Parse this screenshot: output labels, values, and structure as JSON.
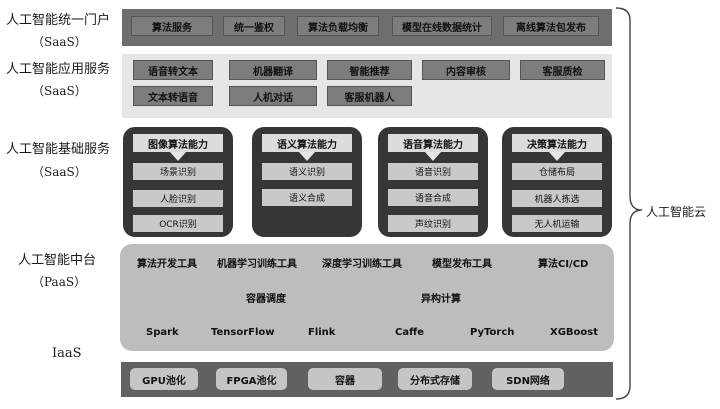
{
  "left_labels": {
    "portal_title": "人工智能统一门户",
    "portal_sub": "（SaaS）",
    "app_title": "人工智能应用服务",
    "app_sub": "（SaaS）",
    "basic_title": "人工智能基础服务",
    "basic_sub": "（SaaS）",
    "middle_title": "人工智能中台",
    "middle_sub": "（PaaS）",
    "iaas_title": "IaaS"
  },
  "portal": [
    "算法服务",
    "统一鉴权",
    "算法负载均衡",
    "模型在线数据统计",
    "离线算法包发布"
  ],
  "app_services": {
    "row1": [
      "语音转文本",
      "机器翻译",
      "智能推荐",
      "内容审核",
      "客服质检"
    ],
    "row2": [
      "文本转语音",
      "人机对话",
      "客服机器人"
    ]
  },
  "capabilities": [
    {
      "title": "图像算法能力",
      "items": [
        "场景识别",
        "人脸识别",
        "OCR识别"
      ]
    },
    {
      "title": "语义算法能力",
      "items": [
        "语义识别",
        "语义合成"
      ]
    },
    {
      "title": "语音算法能力",
      "items": [
        "语音识别",
        "语音合成",
        "声纹识别"
      ]
    },
    {
      "title": "决策算法能力",
      "items": [
        "仓储布局",
        "机器人拣选",
        "无人机运输"
      ]
    }
  ],
  "middle_platform": {
    "tools": [
      "算法开发工具",
      "机器学习训练工具",
      "深度学习训练工具",
      "模型发布工具",
      "算法CI/CD"
    ],
    "scheduling": [
      "容器调度",
      "异构计算"
    ],
    "frameworks": [
      "Spark",
      "TensorFlow",
      "Flink",
      "Caffe",
      "PyTorch",
      "XGBoost"
    ]
  },
  "iaas": [
    "GPU池化",
    "FPGA池化",
    "容器",
    "分布式存储",
    "SDN网络"
  ],
  "cloud_label": "人工智能云"
}
